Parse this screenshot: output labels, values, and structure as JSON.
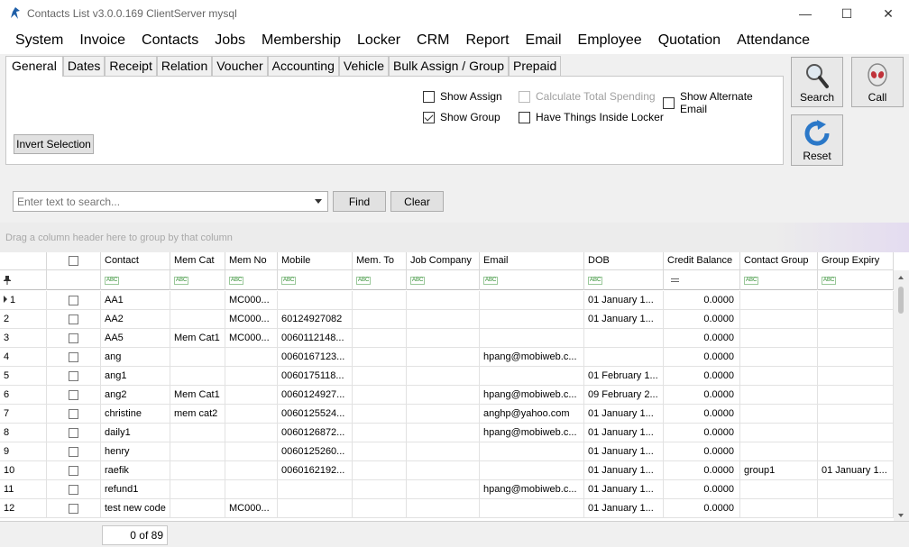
{
  "window": {
    "title": "Contacts List v3.0.0.169 ClientServer mysql",
    "minimize": "—",
    "maximize": "☐",
    "close": "✕"
  },
  "menu": [
    "System",
    "Invoice",
    "Contacts",
    "Jobs",
    "Membership",
    "Locker",
    "CRM",
    "Report",
    "Email",
    "Employee",
    "Quotation",
    "Attendance"
  ],
  "tabs": [
    "General",
    "Dates",
    "Receipt",
    "Relation",
    "Voucher",
    "Accounting",
    "Vehicle",
    "Bulk Assign / Group",
    "Prepaid"
  ],
  "active_tab": "General",
  "options": {
    "show_assign": {
      "label": "Show Assign",
      "checked": false
    },
    "calculate_total_spending": {
      "label": "Calculate Total Spending",
      "checked": false,
      "disabled": true
    },
    "show_alternate_email": {
      "label": "Show Alternate Email",
      "checked": false
    },
    "show_group": {
      "label": "Show Group",
      "checked": true
    },
    "have_things_inside_locker": {
      "label": "Have Things Inside Locker",
      "checked": false
    }
  },
  "invert_selection": "Invert Selection",
  "actions": {
    "search": "Search",
    "call": "Call",
    "reset": "Reset"
  },
  "search": {
    "placeholder": "Enter text to search...",
    "find": "Find",
    "clear": "Clear"
  },
  "group_panel_hint": "Drag a column header here to group by that column",
  "columns": [
    "",
    "",
    "Contact",
    "Mem Cat",
    "Mem No",
    "Mobile",
    "Mem. To",
    "Job Company",
    "Email",
    "DOB",
    "Credit Balance",
    "Contact Group",
    "Group Expiry"
  ],
  "rows": [
    {
      "n": "1",
      "contact": "AA1",
      "memcat": "",
      "memno": "MC000...",
      "mobile": "",
      "memto": "",
      "job": "",
      "email": "",
      "dob": "01 January 1...",
      "credit": "0.0000",
      "group": "",
      "expiry": ""
    },
    {
      "n": "2",
      "contact": "AA2",
      "memcat": "",
      "memno": "MC000...",
      "mobile": "60124927082",
      "memto": "",
      "job": "",
      "email": "",
      "dob": "01 January 1...",
      "credit": "0.0000",
      "group": "",
      "expiry": ""
    },
    {
      "n": "3",
      "contact": "AA5",
      "memcat": "Mem Cat1",
      "memno": "MC000...",
      "mobile": "0060112148...",
      "memto": "",
      "job": "",
      "email": "",
      "dob": "",
      "credit": "0.0000",
      "group": "",
      "expiry": ""
    },
    {
      "n": "4",
      "contact": "ang",
      "memcat": "",
      "memno": "",
      "mobile": "0060167123...",
      "memto": "",
      "job": "",
      "email": "hpang@mobiweb.c...",
      "dob": "",
      "credit": "0.0000",
      "group": "",
      "expiry": ""
    },
    {
      "n": "5",
      "contact": "ang1",
      "memcat": "",
      "memno": "",
      "mobile": "0060175118...",
      "memto": "",
      "job": "",
      "email": "",
      "dob": "01 February 1...",
      "credit": "0.0000",
      "group": "",
      "expiry": ""
    },
    {
      "n": "6",
      "contact": "ang2",
      "memcat": "Mem Cat1",
      "memno": "",
      "mobile": "0060124927...",
      "memto": "",
      "job": "",
      "email": "hpang@mobiweb.c...",
      "dob": "09 February 2...",
      "credit": "0.0000",
      "group": "",
      "expiry": ""
    },
    {
      "n": "7",
      "contact": "christine",
      "memcat": "mem cat2",
      "memno": "",
      "mobile": "0060125524...",
      "memto": "",
      "job": "",
      "email": "anghp@yahoo.com",
      "dob": "01 January 1...",
      "credit": "0.0000",
      "group": "",
      "expiry": ""
    },
    {
      "n": "8",
      "contact": "daily1",
      "memcat": "",
      "memno": "",
      "mobile": "0060126872...",
      "memto": "",
      "job": "",
      "email": "hpang@mobiweb.c...",
      "dob": "01 January 1...",
      "credit": "0.0000",
      "group": "",
      "expiry": ""
    },
    {
      "n": "9",
      "contact": "henry",
      "memcat": "",
      "memno": "",
      "mobile": "0060125260...",
      "memto": "",
      "job": "",
      "email": "",
      "dob": "01 January 1...",
      "credit": "0.0000",
      "group": "",
      "expiry": ""
    },
    {
      "n": "10",
      "contact": "raefik",
      "memcat": "",
      "memno": "",
      "mobile": "0060162192...",
      "memto": "",
      "job": "",
      "email": "",
      "dob": "01 January 1...",
      "credit": "0.0000",
      "group": "group1",
      "expiry": "01 January 1..."
    },
    {
      "n": "11",
      "contact": "refund1",
      "memcat": "",
      "memno": "",
      "mobile": "",
      "memto": "",
      "job": "",
      "email": "hpang@mobiweb.c...",
      "dob": "01 January 1...",
      "credit": "0.0000",
      "group": "",
      "expiry": ""
    },
    {
      "n": "12",
      "contact": "test new code",
      "memcat": "",
      "memno": "MC000...",
      "mobile": "",
      "memto": "",
      "job": "",
      "email": "",
      "dob": "01 January 1...",
      "credit": "0.0000",
      "group": "",
      "expiry": ""
    }
  ],
  "record_counter": "0 of 89"
}
